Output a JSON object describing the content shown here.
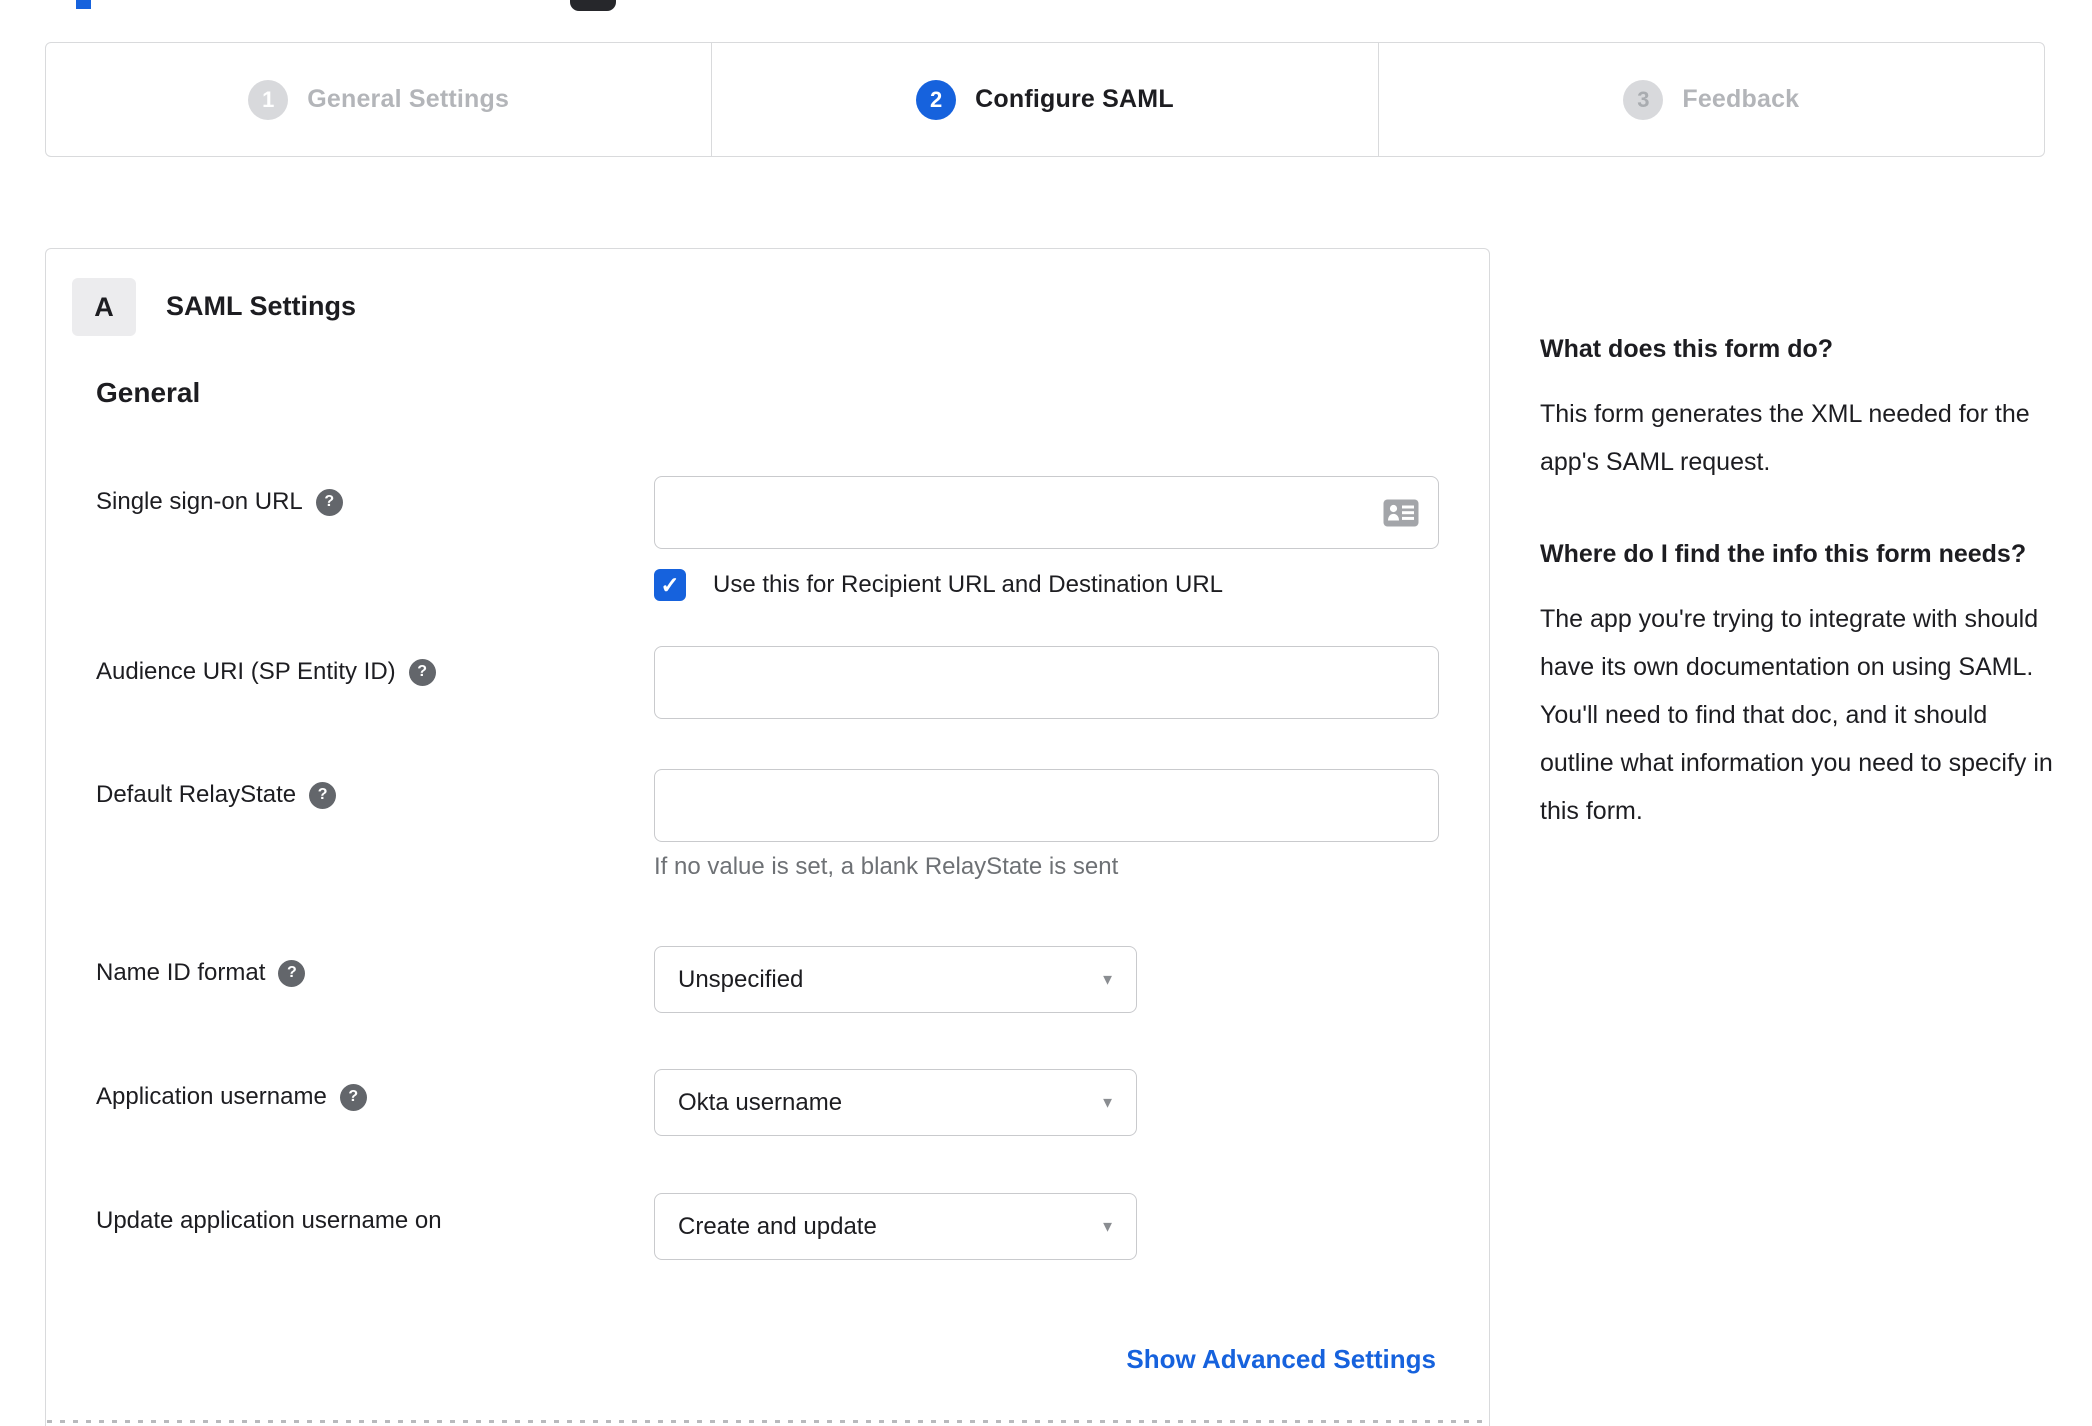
{
  "wizard": {
    "steps": [
      {
        "number": "1",
        "label": "General Settings",
        "state": "done"
      },
      {
        "number": "2",
        "label": "Configure SAML",
        "state": "active"
      },
      {
        "number": "3",
        "label": "Feedback",
        "state": "upcoming"
      }
    ]
  },
  "form": {
    "section_badge": "A",
    "section_title": "SAML Settings",
    "group_title": "General",
    "fields": {
      "sso_url": {
        "label": "Single sign-on URL",
        "value": "",
        "has_help": true
      },
      "sso_checkbox": {
        "checked": true,
        "label": "Use this for Recipient URL and Destination URL"
      },
      "audience_uri": {
        "label": "Audience URI (SP Entity ID)",
        "value": "",
        "has_help": true
      },
      "default_relay_state": {
        "label": "Default RelayState",
        "value": "",
        "has_help": true,
        "hint": "If no value is set, a blank RelayState is sent"
      },
      "name_id_format": {
        "label": "Name ID format",
        "value": "Unspecified",
        "has_help": true
      },
      "application_username": {
        "label": "Application username",
        "value": "Okta username",
        "has_help": true
      },
      "update_app_username_on": {
        "label": "Update application username on",
        "value": "Create and update",
        "has_help": false
      }
    },
    "show_advanced_label": "Show Advanced Settings"
  },
  "sidebar": {
    "q1_title": "What does this form do?",
    "q1_body": "This form generates the XML needed for the app's SAML request.",
    "q2_title": "Where do I find the info this form needs?",
    "q2_body": "The app you're trying to integrate with should have its own documentation on using SAML. You'll need to find that doc, and it should outline what information you need to specify in this form."
  },
  "icons": {
    "help_glyph": "?",
    "check_glyph": "✓",
    "caret_glyph": "▼"
  },
  "colors": {
    "accent_blue": "#1662dd",
    "active_text": "#1d1d21",
    "inactive_gray": "#b3b5b9",
    "circle_gray": "#d8d9dc",
    "link_blue": "#1662dd"
  }
}
